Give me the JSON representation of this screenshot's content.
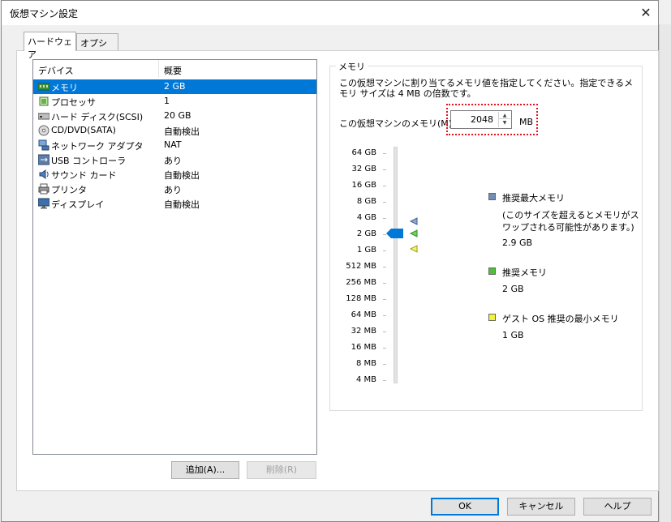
{
  "window": {
    "title": "仮想マシン設定",
    "close_label": "✕"
  },
  "tabs": [
    {
      "label": "ハードウェア"
    },
    {
      "label": "オプション"
    }
  ],
  "devices": {
    "header": {
      "device": "デバイス",
      "summary": "概要"
    },
    "items": [
      {
        "name": "メモリ",
        "value": "2 GB",
        "icon": "memory-icon"
      },
      {
        "name": "プロセッサ",
        "value": "1",
        "icon": "processor-icon"
      },
      {
        "name": "ハード ディスク(SCSI)",
        "value": "20 GB",
        "icon": "hard-disk-icon"
      },
      {
        "name": "CD/DVD(SATA)",
        "value": "自動検出",
        "icon": "cd-dvd-icon"
      },
      {
        "name": "ネットワーク アダプタ",
        "value": "NAT",
        "icon": "network-adapter-icon"
      },
      {
        "name": "USB コントローラ",
        "value": "あり",
        "icon": "usb-controller-icon"
      },
      {
        "name": "サウンド カード",
        "value": "自動検出",
        "icon": "sound-card-icon"
      },
      {
        "name": "プリンタ",
        "value": "あり",
        "icon": "printer-icon"
      },
      {
        "name": "ディスプレイ",
        "value": "自動検出",
        "icon": "display-icon"
      }
    ],
    "add_button": "追加(A)...",
    "remove_button": "削除(R)"
  },
  "memory": {
    "group_label": "メモリ",
    "description": "この仮想マシンに割り当てるメモリ値を指定してください。指定できるメモリ サイズは 4 MB の倍数です。",
    "field_label": "この仮想マシンのメモリ(M):",
    "value": "2048",
    "unit": "MB",
    "slider_ticks": [
      "64 GB",
      "32 GB",
      "16 GB",
      "8 GB",
      "4 GB",
      "2 GB",
      "1 GB",
      "512 MB",
      "256 MB",
      "128 MB",
      "64 MB",
      "32 MB",
      "16 MB",
      "8 MB",
      "4 MB"
    ],
    "slider_selected": "2 GB",
    "legend": {
      "max": {
        "title": "推奨最大メモリ",
        "note": "(このサイズを超えるとメモリがスワップされる可能性があります。)",
        "value": "2.9 GB",
        "color": "#6f8fb8"
      },
      "recommended": {
        "title": "推奨メモリ",
        "value": "2 GB",
        "color": "#4fbf3a"
      },
      "minimum": {
        "title": "ゲスト OS 推奨の最小メモリ",
        "value": "1 GB",
        "color": "#f2f23c"
      }
    }
  },
  "footer": {
    "ok": "OK",
    "cancel": "キャンセル",
    "help": "ヘルプ"
  },
  "colors": {
    "selection": "#0078d7",
    "highlight_box": "#e81123",
    "slider_thumb": "#0078d7"
  }
}
